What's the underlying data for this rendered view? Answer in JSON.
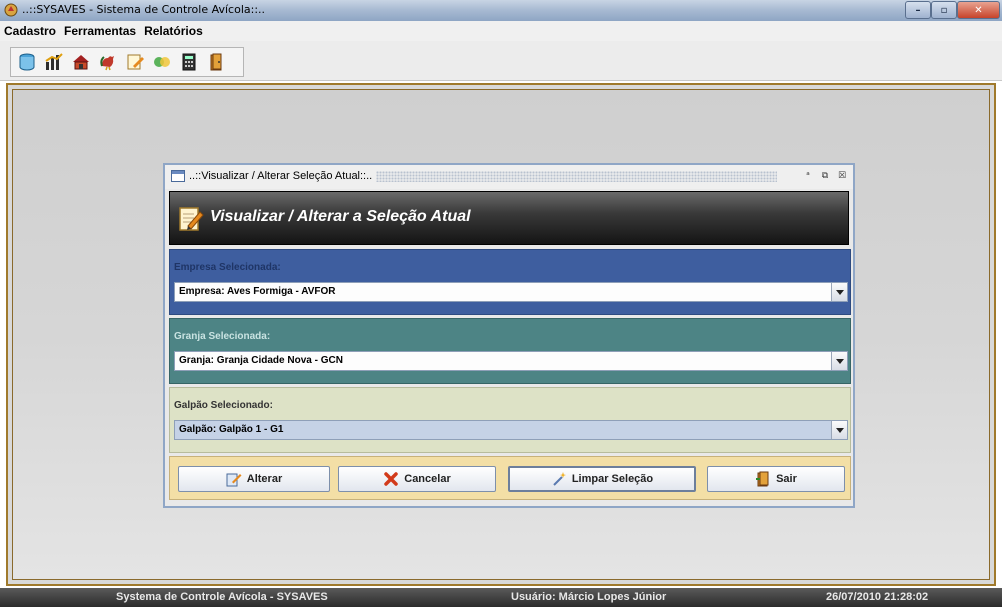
{
  "window": {
    "title": "..::SYSAVES - Sistema de Controle Avícola::..",
    "min_glyph": "–",
    "max_glyph": "▫",
    "close_glyph": "✕"
  },
  "menu": {
    "items": [
      "Cadastro",
      "Ferramentas",
      "Relatórios"
    ]
  },
  "toolbar": {
    "icons": [
      "database-icon",
      "chart-icon",
      "house-icon",
      "rooster-icon",
      "edit-note-icon",
      "transfer-icon",
      "calculator-icon",
      "exit-door-icon"
    ]
  },
  "dialog": {
    "title": "..::Visualizar / Alterar Seleção Atual::..",
    "header": "Visualizar / Alterar a Seleção Atual",
    "frame_buttons": [
      "ᵃ",
      "⧉",
      "☒"
    ],
    "empresa": {
      "label": "Empresa Selecionada:",
      "value": "Empresa: Aves Formiga - AVFOR"
    },
    "granja": {
      "label": "Granja Selecionada:",
      "value": "Granja: Granja Cidade Nova - GCN"
    },
    "galpao": {
      "label": "Galpão Selecionado:",
      "value": "Galpão: Galpão 1 - G1"
    },
    "buttons": {
      "alterar": "Alterar",
      "cancelar": "Cancelar",
      "limpar": "Limpar Seleção",
      "sair": "Sair"
    }
  },
  "status": {
    "system": "Systema de Controle Avícola - SYSAVES",
    "user": "Usuário: Márcio Lopes Júnior",
    "datetime": "26/07/2010 21:28:02"
  },
  "colors": {
    "empresa_bg": "#3e5e9f",
    "granja_bg": "#4d8485",
    "galpao_bg": "#dde2c6",
    "buttonbar_bg": "#f3dfa6",
    "desktop_border": "#a07a2c"
  }
}
